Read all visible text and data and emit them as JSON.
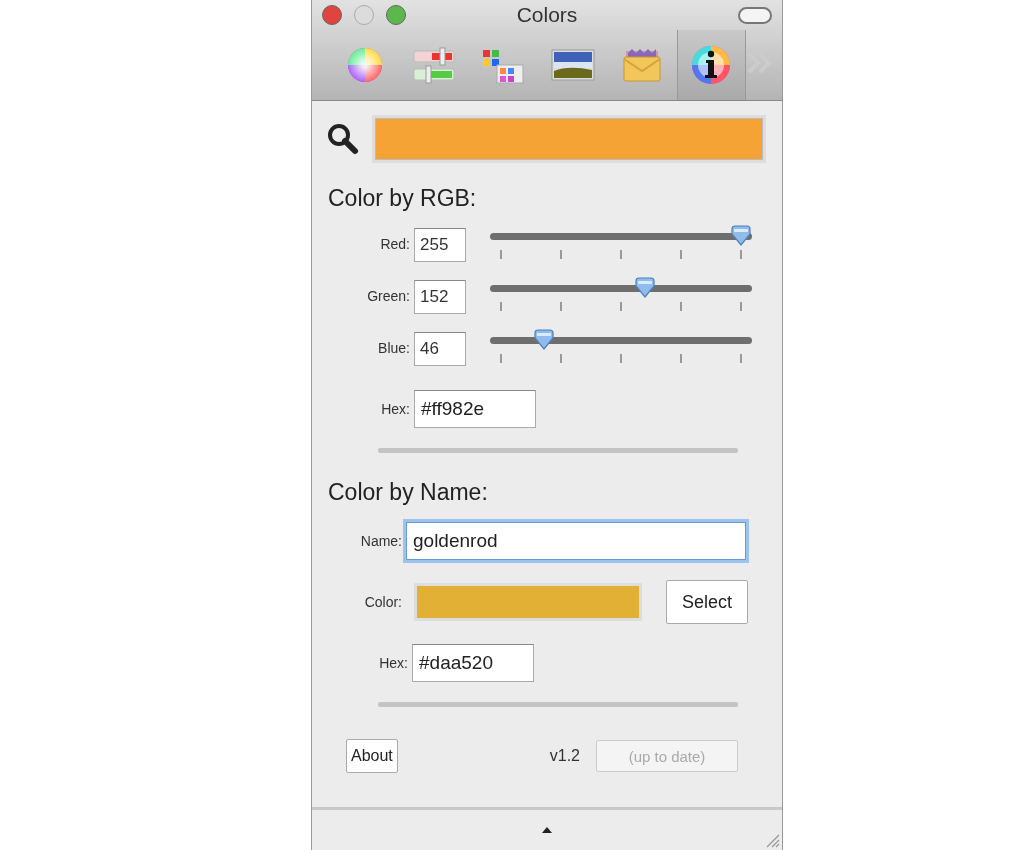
{
  "window": {
    "title": "Colors"
  },
  "window_buttons": [
    {
      "kind": "close",
      "disabled": false
    },
    {
      "kind": "minimize",
      "disabled": true
    },
    {
      "kind": "zoom",
      "disabled": false
    }
  ],
  "toolbar": {
    "items": [
      {
        "kind": "wheel",
        "selected": false
      },
      {
        "kind": "sliders",
        "selected": false
      },
      {
        "kind": "palettes",
        "selected": false
      },
      {
        "kind": "image",
        "selected": false
      },
      {
        "kind": "crayons",
        "selected": false
      },
      {
        "kind": "info",
        "selected": true
      }
    ]
  },
  "current_color": {
    "color": "#f4a334"
  },
  "rgb_section": {
    "title": "Color by RGB:",
    "channels": [
      {
        "label": "Red:",
        "value": "255",
        "level": 1
      },
      {
        "label": "Green:",
        "value": "152",
        "level": 0.6
      },
      {
        "label": "Blue:",
        "value": "46",
        "level": 0.18
      }
    ],
    "hex": {
      "label": "Hex:",
      "value": "#ff982e"
    }
  },
  "name_section": {
    "title": "Color by Name:",
    "name": {
      "label": "Name:",
      "value": "goldenrod",
      "focused": true
    },
    "color": {
      "label": "Color:",
      "color": "#e3b036"
    },
    "select_button": "Select",
    "hex": {
      "label": "Hex:",
      "value": "#daa520"
    }
  },
  "footer": {
    "about_button": "About",
    "version": "v1.2",
    "status": {
      "label": "(up to date)",
      "disabled": true
    }
  }
}
